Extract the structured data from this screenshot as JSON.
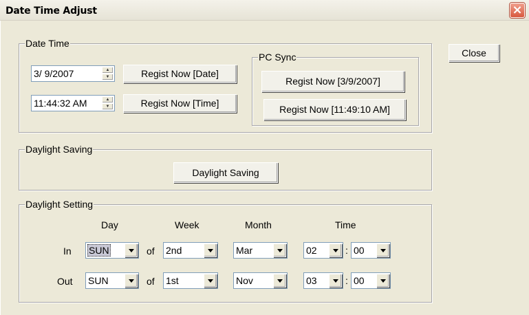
{
  "window": {
    "title": "Date Time Adjust",
    "close_glyph": "×"
  },
  "close_button": "Close",
  "date_time": {
    "legend": "Date Time",
    "date_value": "3/  9/2007",
    "time_value": "11:44:32 AM",
    "regist_date_label": "Regist Now [Date]",
    "regist_time_label": "Regist Now [Time]",
    "spinner_icon": "spin-up-down-icon"
  },
  "pc_sync": {
    "legend": "PC Sync",
    "regist_date_label": "Regist Now [3/9/2007]",
    "regist_time_label": "Regist Now [11:49:10 AM]"
  },
  "daylight_saving": {
    "legend": "Daylight Saving",
    "button_label": "Daylight Saving"
  },
  "daylight_setting": {
    "legend": "Daylight Setting",
    "headers": {
      "day": "Day",
      "week": "Week",
      "month": "Month",
      "time": "Time"
    },
    "of_label": "of",
    "colon": ":",
    "in": {
      "label": "In",
      "day": "SUN",
      "week": "2nd",
      "month": "Mar",
      "hour": "02",
      "minute": "00"
    },
    "out": {
      "label": "Out",
      "day": "SUN",
      "week": "1st",
      "month": "Nov",
      "hour": "03",
      "minute": "00"
    }
  }
}
